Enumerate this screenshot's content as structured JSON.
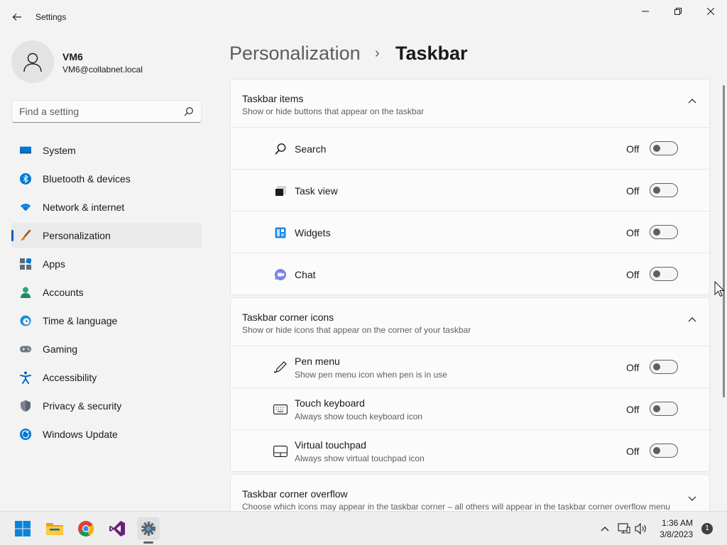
{
  "window": {
    "title": "Settings"
  },
  "profile": {
    "name": "VM6",
    "email": "VM6@collabnet.local"
  },
  "search": {
    "placeholder": "Find a setting"
  },
  "sidebar": {
    "items": [
      {
        "label": "System",
        "icon": "monitor-icon"
      },
      {
        "label": "Bluetooth & devices",
        "icon": "bluetooth-icon"
      },
      {
        "label": "Network & internet",
        "icon": "wifi-icon"
      },
      {
        "label": "Personalization",
        "icon": "brush-icon",
        "active": true
      },
      {
        "label": "Apps",
        "icon": "apps-icon"
      },
      {
        "label": "Accounts",
        "icon": "person-icon"
      },
      {
        "label": "Time & language",
        "icon": "globe-clock-icon"
      },
      {
        "label": "Gaming",
        "icon": "gamepad-icon"
      },
      {
        "label": "Accessibility",
        "icon": "accessibility-icon"
      },
      {
        "label": "Privacy & security",
        "icon": "shield-icon"
      },
      {
        "label": "Windows Update",
        "icon": "update-icon"
      }
    ]
  },
  "breadcrumb": {
    "parent": "Personalization",
    "separator": "›",
    "current": "Taskbar"
  },
  "sections": {
    "taskbar_items": {
      "title": "Taskbar items",
      "subtitle": "Show or hide buttons that appear on the taskbar",
      "rows": [
        {
          "label": "Search",
          "state": "Off",
          "icon": "search-icon"
        },
        {
          "label": "Task view",
          "state": "Off",
          "icon": "task-view-icon"
        },
        {
          "label": "Widgets",
          "state": "Off",
          "icon": "widgets-icon"
        },
        {
          "label": "Chat",
          "state": "Off",
          "icon": "chat-icon"
        }
      ]
    },
    "corner_icons": {
      "title": "Taskbar corner icons",
      "subtitle": "Show or hide icons that appear on the corner of your taskbar",
      "rows": [
        {
          "label": "Pen menu",
          "desc": "Show pen menu icon when pen is in use",
          "state": "Off",
          "icon": "pen-icon"
        },
        {
          "label": "Touch keyboard",
          "desc": "Always show touch keyboard icon",
          "state": "Off",
          "icon": "keyboard-icon"
        },
        {
          "label": "Virtual touchpad",
          "desc": "Always show virtual touchpad icon",
          "state": "Off",
          "icon": "touchpad-icon"
        }
      ]
    },
    "corner_overflow": {
      "title": "Taskbar corner overflow",
      "subtitle": "Choose which icons may appear in the taskbar corner – all others will appear in the taskbar corner overflow menu"
    }
  },
  "taskbar": {
    "apps": [
      "start-icon",
      "file-explorer-icon",
      "chrome-icon",
      "visual-studio-icon",
      "settings-icon"
    ],
    "clock": {
      "time": "1:36 AM",
      "date": "3/8/2023"
    },
    "notification_count": "1"
  },
  "colors": {
    "accent": "#005fb8",
    "background": "#f3f3f3",
    "card": "#fbfbfb"
  }
}
